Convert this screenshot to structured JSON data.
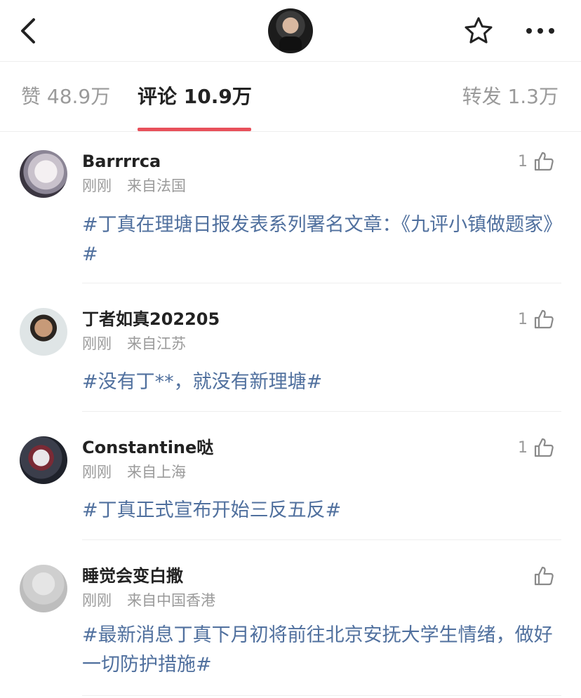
{
  "tabs": {
    "likes": "赞 48.9万",
    "comments": "评论 10.9万",
    "reposts": "转发 1.3万"
  },
  "comments": [
    {
      "user": "Barrrrca",
      "time": "刚刚",
      "location": "来自法国",
      "text": "#丁真在理塘日报发表系列署名文章：《九评小镇做题家》#",
      "likes": "1"
    },
    {
      "user": "丁者如真202205",
      "time": "刚刚",
      "location": "来自江苏",
      "text": "#没有丁**，就没有新理塘#",
      "likes": "1"
    },
    {
      "user": "Constantine哒",
      "time": "刚刚",
      "location": "来自上海",
      "text": "#丁真正式宣布开始三反五反#",
      "likes": "1"
    },
    {
      "user": "睡觉会变白撒",
      "time": "刚刚",
      "location": "来自中国香港",
      "text": "#最新消息丁真下月初将前往北京安抚大学生情绪，做好一切防护措施#",
      "likes": ""
    }
  ],
  "colors": {
    "accent_underline": "#e8505b",
    "topic_text": "#50709e",
    "muted_text": "#9a9a9a"
  },
  "icons": {
    "back": "back-chevron-icon",
    "star": "star-icon",
    "more": "more-dots-icon",
    "like": "thumbs-up-icon"
  }
}
